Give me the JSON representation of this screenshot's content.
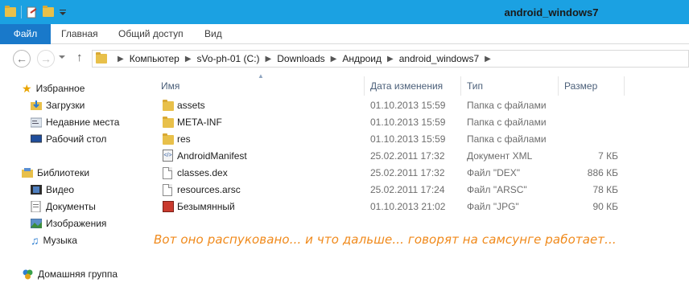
{
  "window": {
    "title": "android_windows7"
  },
  "ribbon": {
    "tabs": [
      {
        "label": "Файл"
      },
      {
        "label": "Главная"
      },
      {
        "label": "Общий доступ"
      },
      {
        "label": "Вид"
      }
    ]
  },
  "address": {
    "crumbs": [
      "Компьютер",
      "sVo-ph-01 (C:)",
      "Downloads",
      "Андроид",
      "android_windows7"
    ]
  },
  "sidebar": {
    "items": [
      {
        "label": "Избранное",
        "icon": "star-icon"
      },
      {
        "label": "Загрузки",
        "icon": "downloads-folder-icon"
      },
      {
        "label": "Недавние места",
        "icon": "recent-places-icon"
      },
      {
        "label": "Рабочий стол",
        "icon": "desktop-icon"
      },
      {
        "label": "Библиотеки",
        "icon": "libraries-icon"
      },
      {
        "label": "Видео",
        "icon": "video-icon"
      },
      {
        "label": "Документы",
        "icon": "documents-icon"
      },
      {
        "label": "Изображения",
        "icon": "pictures-icon"
      },
      {
        "label": "Музыка",
        "icon": "music-icon"
      },
      {
        "label": "Домашняя группа",
        "icon": "homegroup-icon"
      }
    ]
  },
  "list": {
    "columns": {
      "name": "Имя",
      "date": "Дата изменения",
      "type": "Тип",
      "size": "Размер"
    },
    "rows": [
      {
        "name": "assets",
        "date": "01.10.2013 15:59",
        "type": "Папка с файлами",
        "size": "",
        "icon": "folder-icon"
      },
      {
        "name": "META-INF",
        "date": "01.10.2013 15:59",
        "type": "Папка с файлами",
        "size": "",
        "icon": "folder-icon"
      },
      {
        "name": "res",
        "date": "01.10.2013 15:59",
        "type": "Папка с файлами",
        "size": "",
        "icon": "folder-icon"
      },
      {
        "name": "AndroidManifest",
        "date": "25.02.2011 17:32",
        "type": "Документ XML",
        "size": "7 КБ",
        "icon": "xml-file-icon"
      },
      {
        "name": "classes.dex",
        "date": "25.02.2011 17:32",
        "type": "Файл \"DEX\"",
        "size": "886 КБ",
        "icon": "file-icon"
      },
      {
        "name": "resources.arsc",
        "date": "25.02.2011 17:24",
        "type": "Файл \"ARSC\"",
        "size": "78 КБ",
        "icon": "file-icon"
      },
      {
        "name": "Безымянный",
        "date": "01.10.2013 21:02",
        "type": "Файл \"JPG\"",
        "size": "90 КБ",
        "icon": "image-file-icon"
      }
    ]
  },
  "comment": "Вот оно распуковано... и что дальше... говорят на самсунге работает..."
}
